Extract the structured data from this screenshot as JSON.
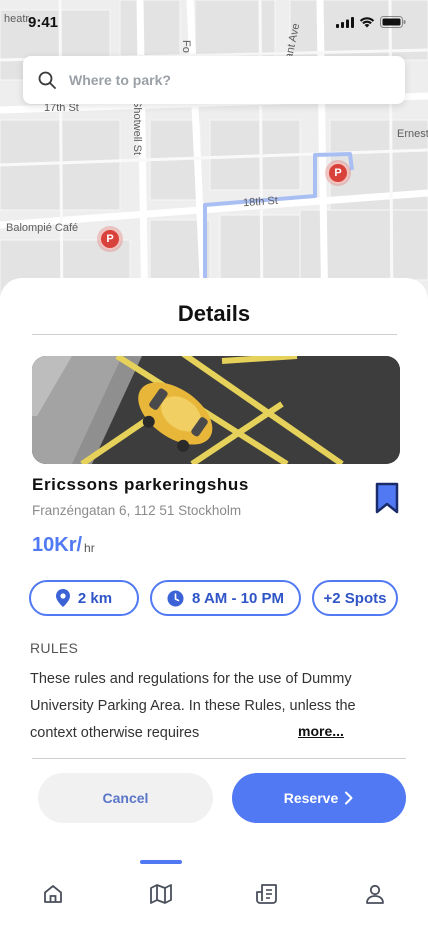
{
  "status_bar": {
    "time": "9:41"
  },
  "map": {
    "street_labels": {
      "a": "heatr",
      "b": "17th St",
      "c": "Shotwell St",
      "d": "Fo",
      "e": "ant Ave",
      "f": "Ernest",
      "g": "18th St",
      "h": "Balompié Café"
    },
    "parking_marker": "P"
  },
  "search": {
    "placeholder": "Where to park?"
  },
  "details": {
    "title": "Details",
    "name": "Ericssons parkeringshus",
    "address": "Franzéngatan 6, 112 51 Stockholm",
    "price": "10Kr/",
    "price_unit": "hr",
    "chips": {
      "distance": "2 km",
      "hours": "8 AM - 10 PM",
      "spots": "+2 Spots"
    },
    "rules_title": "RULES",
    "rules_text": "These rules and regulations for the use of Dummy University Parking Area. In these Rules, unless the context otherwise requires",
    "more": "more..."
  },
  "actions": {
    "cancel": "Cancel",
    "reserve": "Reserve"
  },
  "nav": {
    "active": "map"
  },
  "colors": {
    "accent": "#5079f3",
    "marker": "#d9423a"
  }
}
